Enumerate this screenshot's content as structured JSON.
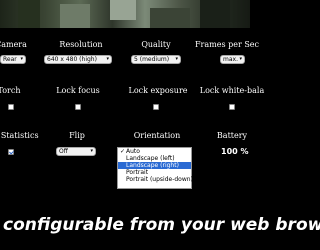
{
  "labels": {
    "camera": "Camera",
    "resolution": "Resolution",
    "quality": "Quality",
    "fps": "Frames per Sec",
    "torch": "Torch",
    "lock_focus": "Lock focus",
    "lock_exposure": "Lock exposure",
    "lock_white_balance": "Lock white-bala",
    "show_statistics": "w Statistics",
    "flip": "Flip",
    "orientation": "Orientation",
    "battery": "Battery"
  },
  "selects": {
    "camera": "Rear",
    "resolution": "640 x 480 (high)",
    "quality": "5 (medium)",
    "fps": "max.",
    "flip": "Off"
  },
  "checkboxes": {
    "torch": false,
    "lock_focus": false,
    "lock_exposure": false,
    "lock_white_balance": false,
    "show_statistics": true
  },
  "orientation_options": [
    "Auto",
    "Landscape (left)",
    "Landscape (right)",
    "Portrait",
    "Portrait (upside-down)"
  ],
  "orientation_selected": "Auto",
  "orientation_highlighted": "Landscape (right)",
  "battery_value": "100 %",
  "banner": "y configurable from your web brow",
  "colors": {
    "highlight": "#2a6ad3",
    "background": "#000000"
  }
}
